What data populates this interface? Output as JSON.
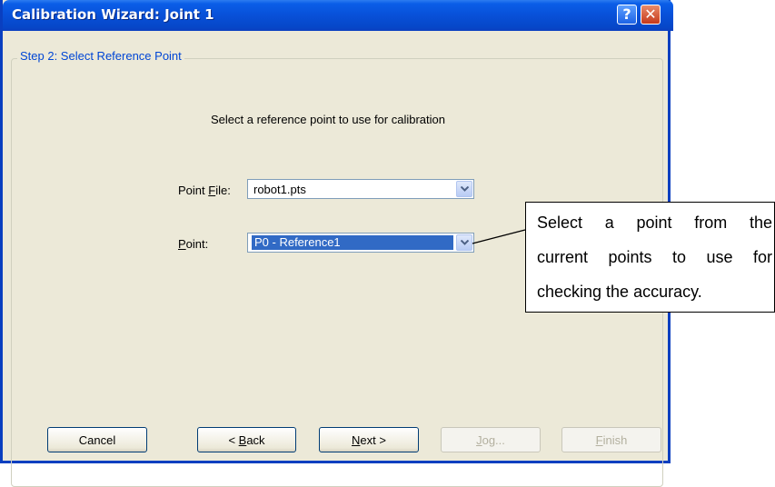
{
  "window": {
    "title": "Calibration Wizard: Joint 1",
    "help_glyph": "?",
    "close_glyph": "✕",
    "accent_color": "#0a5ee8"
  },
  "step": {
    "label": "Step 2: Select Reference Point",
    "instruction": "Select a reference point to use for calibration"
  },
  "point_file": {
    "label_prefix": "Point ",
    "label_mnemonic": "F",
    "label_suffix": "ile:",
    "value": "robot1.pts"
  },
  "point": {
    "label_mnemonic": "P",
    "label_suffix": "oint:",
    "value": "P0 - Reference1"
  },
  "buttons": {
    "cancel": "Cancel",
    "back_prefix": "< ",
    "back_mnemonic": "B",
    "back_suffix": "ack",
    "next_mnemonic": "N",
    "next_suffix": "ext >",
    "jog_mnemonic": "J",
    "jog_suffix": "og...",
    "finish_mnemonic": "F",
    "finish_suffix": "inish"
  },
  "callout": {
    "line1": "Select a point from the",
    "line2": "current points to use for",
    "line3": "checking the accuracy."
  }
}
